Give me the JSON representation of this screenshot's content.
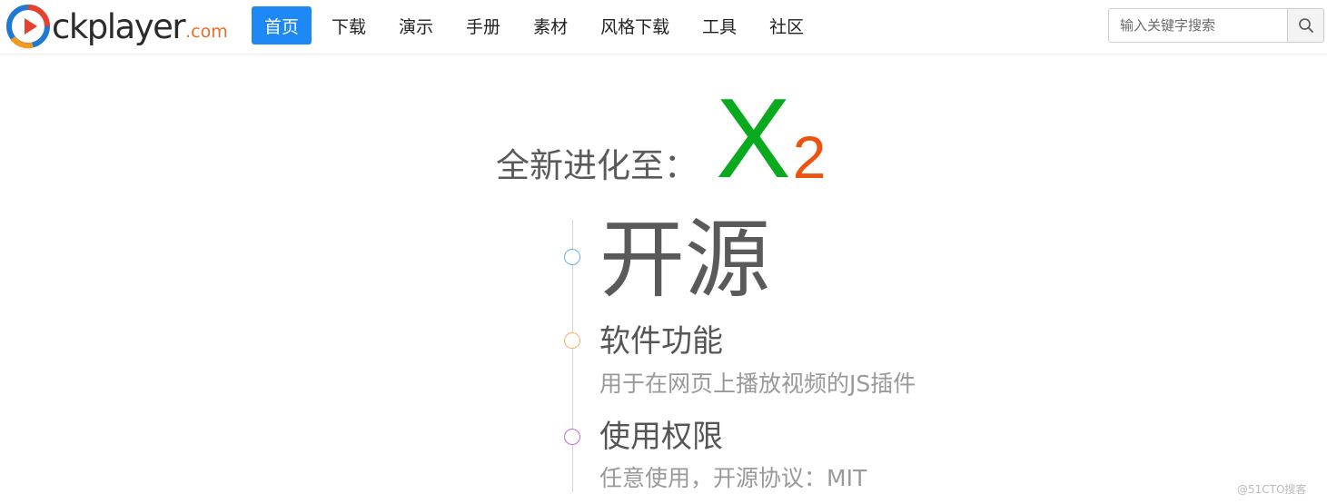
{
  "logo": {
    "text": "ckplayer",
    "suffix": ".com"
  },
  "nav": [
    {
      "label": "首页",
      "active": true
    },
    {
      "label": "下载"
    },
    {
      "label": "演示"
    },
    {
      "label": "手册"
    },
    {
      "label": "素材"
    },
    {
      "label": "风格下载"
    },
    {
      "label": "工具"
    },
    {
      "label": "社区"
    }
  ],
  "search": {
    "placeholder": "输入关键字搜索",
    "icon": "search-icon"
  },
  "hero": {
    "prefix": "全新进化至：",
    "version_letter": "X",
    "version_number": "2"
  },
  "timeline": [
    {
      "title": "开源",
      "color": "#6aaee8"
    },
    {
      "title": "软件功能",
      "desc": "用于在网页上播放视频的JS插件",
      "color": "#f5b26b"
    },
    {
      "title": "使用权限",
      "desc": "任意使用，开源协议：MIT",
      "color": "#c86ae0"
    }
  ],
  "colors": {
    "accent": "#1e88f5",
    "version_x": "#0aaa1e",
    "version_2": "#f0520e"
  },
  "watermark": "@51CTO搜客"
}
